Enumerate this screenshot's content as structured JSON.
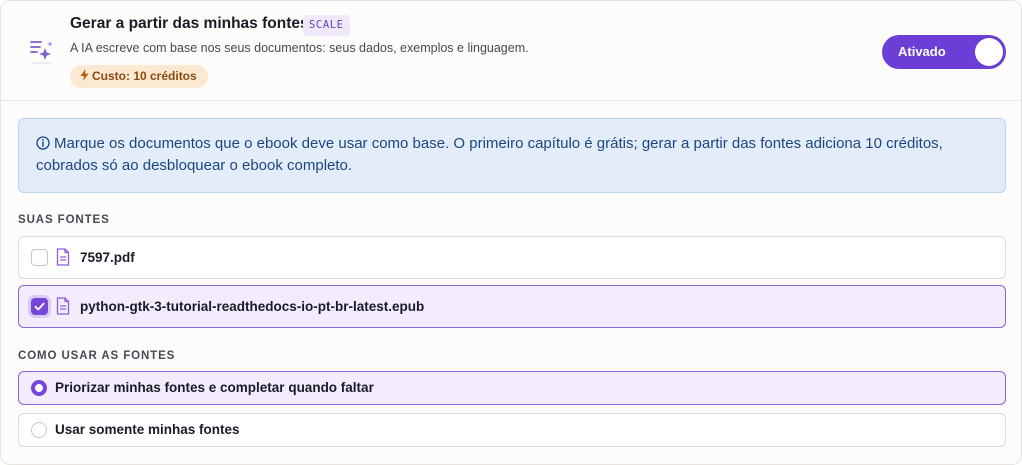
{
  "header": {
    "title": "Gerar a partir das minhas fontes",
    "badge": "SCALE",
    "description": "A IA escreve com base nos seus documentos: seus dados, exemplos e linguagem.",
    "cost": "Custo: 10 créditos",
    "icon": "sparkle-list-icon",
    "toggle": {
      "label": "Ativado",
      "state": "on"
    }
  },
  "info": {
    "icon": "info-icon",
    "text": "Marque os documentos que o ebook deve usar como base. O primeiro capítulo é grátis; gerar a partir das fontes adiciona 10 créditos, cobrados só ao desbloquear o ebook completo."
  },
  "sources": {
    "label": "SUAS FONTES",
    "items": [
      {
        "name": "7597.pdf",
        "checked": false,
        "icon": "file-icon"
      },
      {
        "name": "python-gtk-3-tutorial-readthedocs-io-pt-br-latest.epub",
        "checked": true,
        "icon": "file-icon"
      }
    ]
  },
  "usage": {
    "label": "COMO USAR AS FONTES",
    "options": [
      {
        "label": "Priorizar minhas fontes e completar quando faltar",
        "selected": true
      },
      {
        "label": "Usar somente minhas fontes",
        "selected": false
      }
    ]
  },
  "colors": {
    "accent": "#6b3fd6",
    "info_bg": "#e3edf9",
    "info_text": "#1d4681",
    "cost_bg": "#fbe9d2",
    "selected_bg": "#f3ecfd"
  }
}
